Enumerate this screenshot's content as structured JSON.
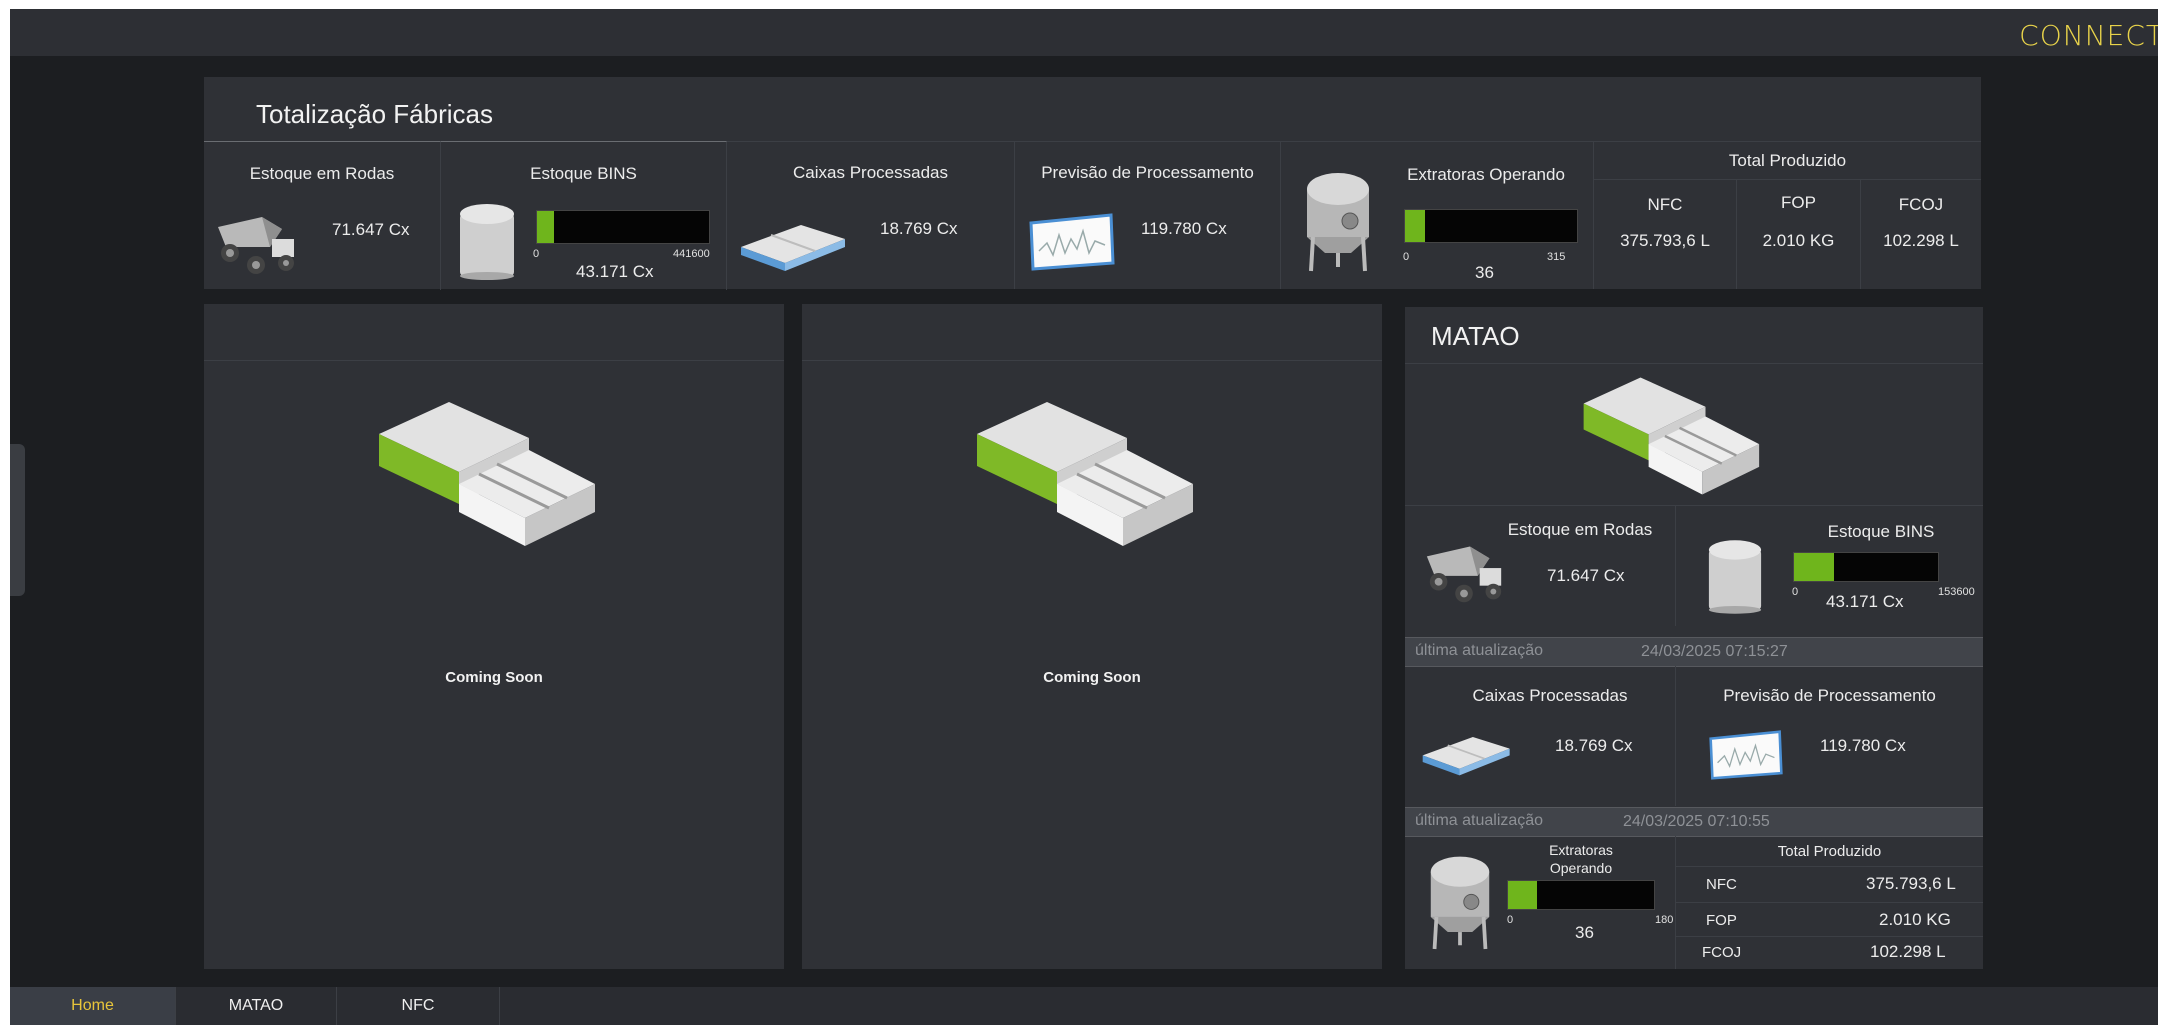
{
  "app": {
    "logo": "CONNECT"
  },
  "summary": {
    "title": "Totalização Fábricas",
    "estoque_rodas": {
      "label": "Estoque em Rodas",
      "value": "71.647 Cx"
    },
    "estoque_bins": {
      "label": "Estoque BINS",
      "value": "43.171 Cx",
      "min": "0",
      "max": "441600",
      "fill": 0.098
    },
    "caixas": {
      "label": "Caixas Processadas",
      "value": "18.769 Cx"
    },
    "previsao": {
      "label": "Previsão de Processamento",
      "value": "119.780 Cx"
    },
    "extratoras": {
      "label": "Extratoras Operando",
      "value": "36",
      "min": "0",
      "max": "315",
      "fill": 0.114
    },
    "total": {
      "label": "Total Produzido",
      "items": [
        {
          "name": "NFC",
          "value": "375.793,6 L"
        },
        {
          "name": "FOP",
          "value": "2.010 KG"
        },
        {
          "name": "FCOJ",
          "value": "102.298 L"
        }
      ]
    }
  },
  "panels": [
    {
      "coming_soon": "Coming Soon"
    },
    {
      "coming_soon": "Coming Soon"
    }
  ],
  "matao": {
    "title": "MATAO",
    "estoque_rodas": {
      "label": "Estoque em Rodas",
      "value": "71.647 Cx"
    },
    "estoque_bins": {
      "label": "Estoque BINS",
      "value": "43.171 Cx",
      "min": "0",
      "max": "153600",
      "fill": 0.281
    },
    "update1": {
      "label": "última atualização",
      "time": "24/03/2025 07:15:27"
    },
    "caixas": {
      "label": "Caixas Processadas",
      "value": "18.769 Cx"
    },
    "previsao": {
      "label": "Previsão de Processamento",
      "value": "119.780 Cx"
    },
    "update2": {
      "label": "última atualização",
      "time": "24/03/2025 07:10:55"
    },
    "extratoras": {
      "label_line1": "Extratoras",
      "label_line2": "Operando",
      "value": "36",
      "min": "0",
      "max": "180",
      "fill": 0.2
    },
    "total": {
      "label": "Total Produzido",
      "items": [
        {
          "name": "NFC",
          "value": "375.793,6 L"
        },
        {
          "name": "FOP",
          "value": "2.010 KG"
        },
        {
          "name": "FCOJ",
          "value": "102.298 L"
        }
      ]
    }
  },
  "tabs": [
    {
      "label": "Home",
      "active": true
    },
    {
      "label": "MATAO",
      "active": false
    },
    {
      "label": "NFC",
      "active": false
    }
  ],
  "colors": {
    "accent": "#e8c53a",
    "bar_fill": "#6fb51c",
    "panel": "#2f3136",
    "background": "#1c1e21"
  }
}
